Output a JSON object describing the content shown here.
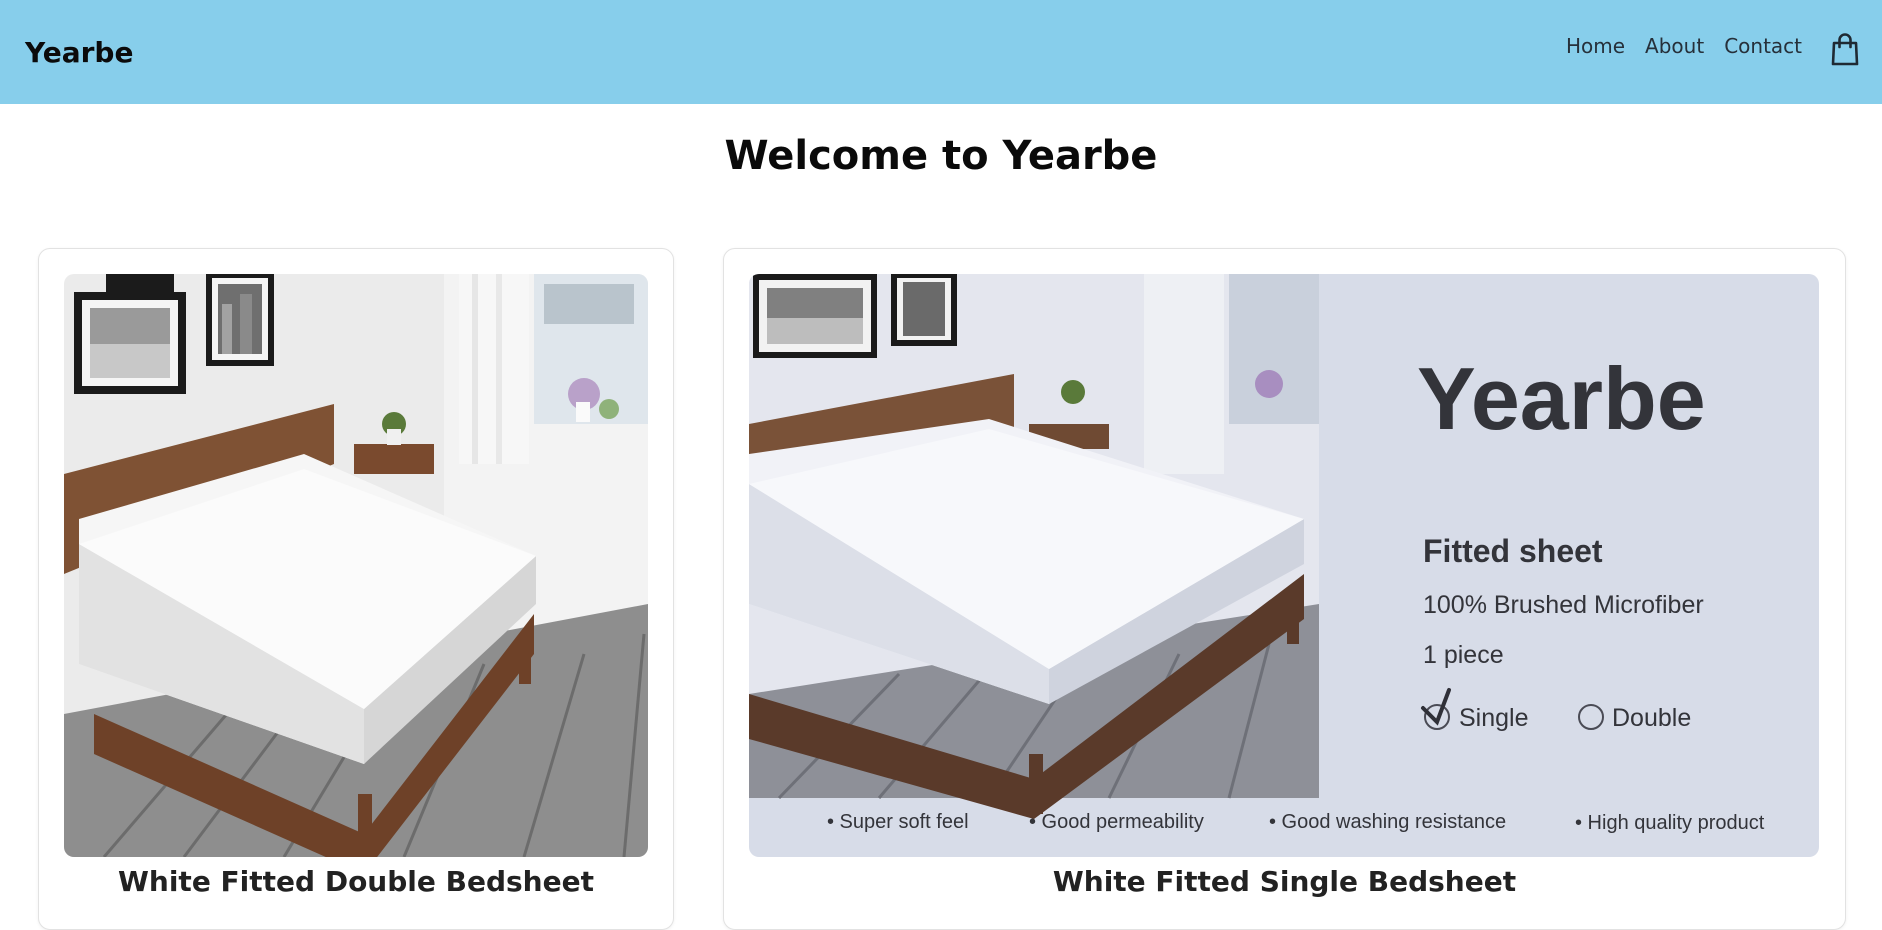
{
  "header": {
    "brand": "Yearbe",
    "nav": [
      {
        "label": "Home"
      },
      {
        "label": "About"
      },
      {
        "label": "Contact"
      }
    ],
    "cart_icon": "shopping-bag-icon",
    "background": "#87ceeb"
  },
  "main": {
    "title": "Welcome to Yearbe"
  },
  "products": [
    {
      "name": "White Fitted Double Bedsheet",
      "image": "bed-photo"
    },
    {
      "name": "White Fitted Single Bedsheet",
      "image": "bed-promo-photo",
      "promo": {
        "brand": "Yearbe",
        "heading": "Fitted sheet",
        "material": "100% Brushed Microfiber",
        "pieces": "1 piece",
        "options": [
          "Single",
          "Double"
        ],
        "selected": "Single",
        "features": [
          "• Super soft feel",
          "• Good permeability",
          "• Good washing resistance",
          "• High quality product"
        ]
      }
    }
  ]
}
